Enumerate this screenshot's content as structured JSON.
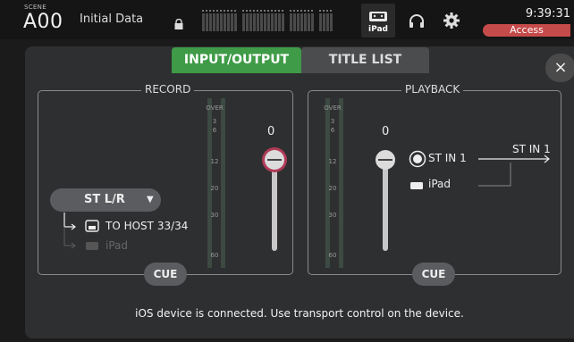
{
  "topbar": {
    "scene_label": "SCENE",
    "scene_number": "A00",
    "scene_name": "Initial Data",
    "ipad_label": "iPad",
    "clock": "9:39:31",
    "access_label": "Access",
    "icons": [
      "lock-icon",
      "ipad-icon",
      "headphones-icon",
      "gear-icon"
    ]
  },
  "tabs": [
    {
      "label": "INPUT/OUTPUT",
      "active": true
    },
    {
      "label": "TITLE LIST",
      "active": false
    }
  ],
  "close_label": "×",
  "record": {
    "title": "RECORD",
    "source": "ST L/R",
    "route_to_host": "TO HOST 33/34",
    "route_ipad": "iPad",
    "meter_labels": [
      "OVER",
      "3",
      "6",
      "12",
      "20",
      "30",
      "60"
    ],
    "fader_value": "0",
    "cue_label": "CUE"
  },
  "playback": {
    "title": "PLAYBACK",
    "meter_labels": [
      "OVER",
      "3",
      "6",
      "12",
      "20",
      "30",
      "60"
    ],
    "fader_value": "0",
    "source_option": "ST IN 1",
    "ipad_option": "iPad",
    "destination": "ST IN 1",
    "cue_label": "CUE"
  },
  "status_message": "iOS device is connected. Use transport control on the device.",
  "colors": {
    "active_tab": "#3f9b47",
    "access": "#c54a4a",
    "selected_fader_ring": "#b03a57"
  }
}
